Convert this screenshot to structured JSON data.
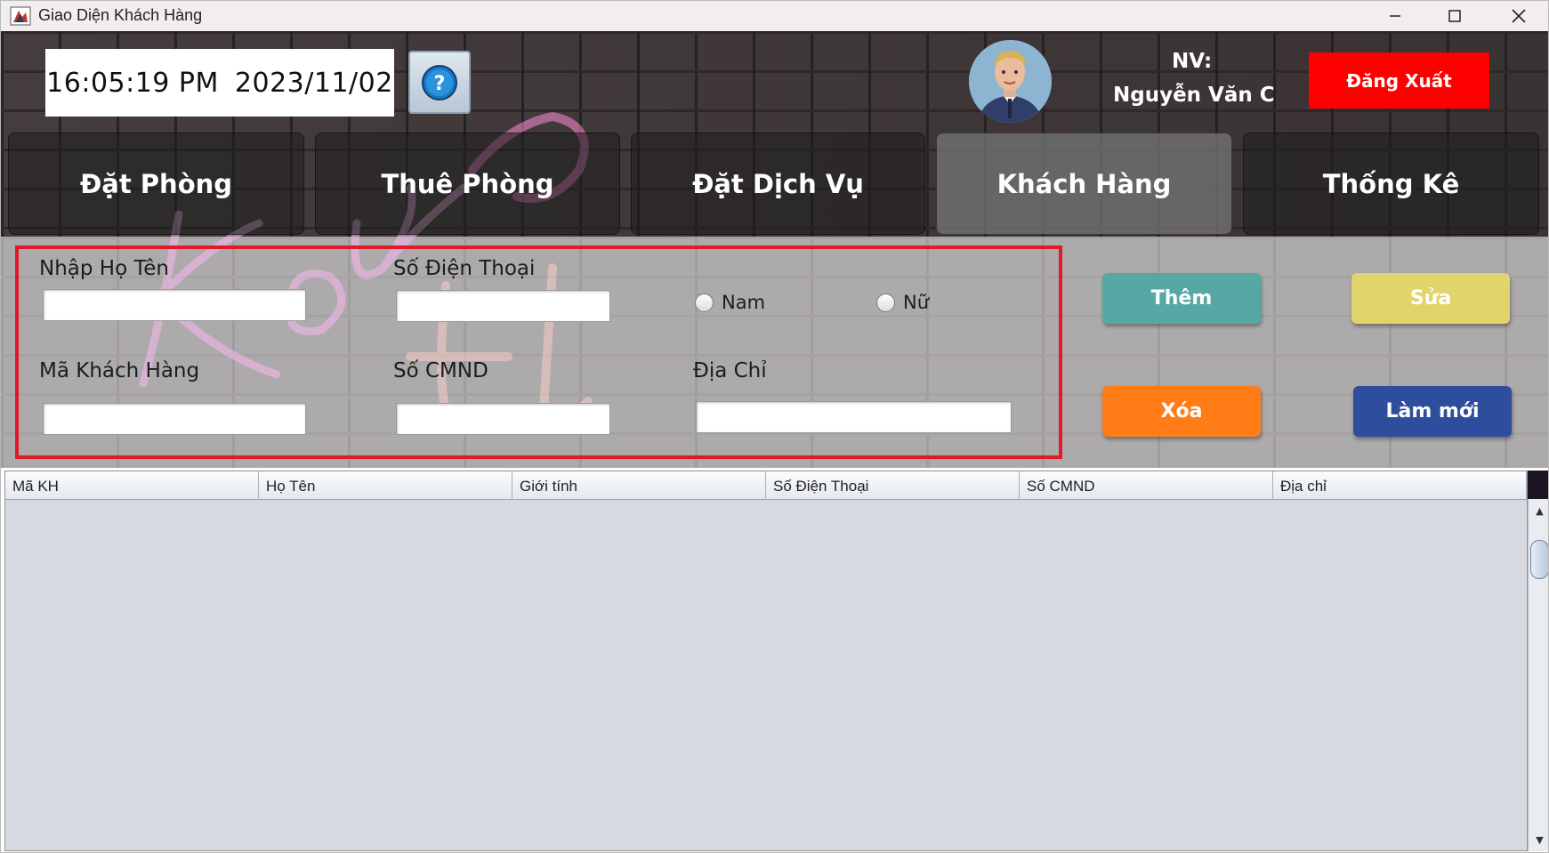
{
  "window": {
    "title": "Giao Diện Khách Hàng",
    "controls": [
      "minimize-icon",
      "maximize-icon",
      "close-icon"
    ]
  },
  "header": {
    "time": "16:05:19 PM",
    "date": "2023/11/02",
    "help_icon": "?",
    "staff_label": "NV:",
    "staff_name": "Nguyễn Văn C",
    "logout_label": "Đăng Xuất"
  },
  "nav": {
    "tabs": [
      {
        "label": "Đặt Phòng",
        "active": false
      },
      {
        "label": "Thuê Phòng",
        "active": false
      },
      {
        "label": "Đặt Dịch Vụ",
        "active": false
      },
      {
        "label": "Khách Hàng",
        "active": true
      },
      {
        "label": "Thống Kê",
        "active": false
      }
    ]
  },
  "form": {
    "name_label": "Nhập Họ Tên",
    "name_value": "",
    "phone_label": "Số Điện Thoại",
    "phone_value": "",
    "gender_male": "Nam",
    "gender_female": "Nữ",
    "gender_selected": "",
    "id_label": "Mã Khách Hàng",
    "id_value": "",
    "cmnd_label": "Số CMND",
    "cmnd_value": "",
    "address_label": "Địa Chỉ",
    "address_value": ""
  },
  "actions": {
    "add_label": "Thêm",
    "edit_label": "Sửa",
    "delete_label": "Xóa",
    "refresh_label": "Làm mới"
  },
  "table": {
    "columns": [
      "Mã KH",
      "Họ Tên",
      "Giới tính",
      "Số Điện Thoại",
      "Số CMND",
      "Địa chỉ"
    ],
    "rows": []
  },
  "colors": {
    "logout": "#ff0000",
    "add": "#56a8a4",
    "edit": "#e1d46a",
    "delete": "#ff7c17",
    "refresh": "#2f4d9d",
    "form_border": "#e0192b"
  }
}
